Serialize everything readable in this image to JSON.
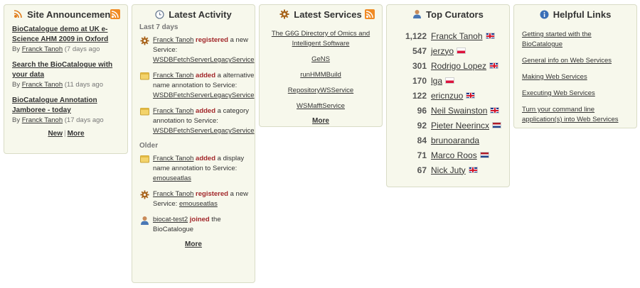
{
  "announcements": {
    "title": "Site Announcements",
    "icon": "broadcast-icon",
    "items": [
      {
        "title": "BioCatalogue demo at UK e-Science AHM 2009 in Oxford",
        "by": "By",
        "author": "Franck Tanoh",
        "ago": "(7 days ago"
      },
      {
        "title": "Search the BioCatalogue with your data",
        "by": "By",
        "author": "Franck Tanoh",
        "ago": "(11 days ago"
      },
      {
        "title": "BioCatalogue Annotation Jamboree - today",
        "by": "By",
        "author": "Franck Tanoh",
        "ago": "(17 days ago"
      }
    ],
    "new_label": "New",
    "separator": "|",
    "more_label": "More"
  },
  "activity": {
    "title": "Latest Activity",
    "icon": "clock-icon",
    "section_recent": "Last 7 days",
    "section_older": "Older",
    "recent": [
      {
        "icon": "gear-icon",
        "user": "Franck Tanoh",
        "verb": "registered",
        "text": "a new Service:",
        "target": "WSDBFetchServerLegacyService"
      },
      {
        "icon": "note-icon",
        "user": "Franck Tanoh",
        "verb": "added",
        "text": "a alternative name annotation to Service:",
        "target": "WSDBFetchServerLegacyService"
      },
      {
        "icon": "note-icon",
        "user": "Franck Tanoh",
        "verb": "added",
        "text": "a category annotation to Service:",
        "target": "WSDBFetchServerLegacyService"
      }
    ],
    "older": [
      {
        "icon": "note-icon",
        "user": "Franck Tanoh",
        "verb": "added",
        "text": "a display name annotation to Service:",
        "target": "emouseatlas"
      },
      {
        "icon": "gear-icon",
        "user": "Franck Tanoh",
        "verb": "registered",
        "text": "a new Service:",
        "target": "emouseatlas"
      },
      {
        "icon": "user-icon",
        "user": "biocat-test2",
        "verb": "joined",
        "text": "the BioCatalogue",
        "target": ""
      }
    ],
    "more_label": "More"
  },
  "services": {
    "title": "Latest Services",
    "icon": "gear-icon",
    "items": [
      "The G6G Directory of Omics and Intelligent Software",
      "GeNS",
      "runHMMBuild",
      "RepositoryWSService",
      "WSMafftService"
    ],
    "more_label": "More"
  },
  "curators": {
    "title": "Top Curators",
    "icon": "user-icon",
    "items": [
      {
        "count": "1,122",
        "name": "Franck Tanoh",
        "flag": "gb"
      },
      {
        "count": "547",
        "name": "jerzyo",
        "flag": "pl"
      },
      {
        "count": "301",
        "name": "Rodrigo Lopez",
        "flag": "gb"
      },
      {
        "count": "170",
        "name": "lga",
        "flag": "pl"
      },
      {
        "count": "122",
        "name": "ericnzuo",
        "flag": "gb"
      },
      {
        "count": "96",
        "name": "Neil Swainston",
        "flag": "gb"
      },
      {
        "count": "92",
        "name": "Pieter Neerincx",
        "flag": "nl"
      },
      {
        "count": "84",
        "name": "brunoaranda",
        "flag": ""
      },
      {
        "count": "71",
        "name": "Marco Roos",
        "flag": "nl"
      },
      {
        "count": "67",
        "name": "Nick Juty",
        "flag": "gb"
      }
    ]
  },
  "links": {
    "title": "Helpful Links",
    "icon": "info-icon",
    "items": [
      "Getting started with the BioCatalogue",
      "General info on Web Services",
      "Making Web Services",
      "Executing Web Services",
      "Turn your command line application(s) into Web Services"
    ]
  },
  "colors": {
    "panel_bg": "#f7f8ec",
    "panel_border": "#d9dcc6",
    "verb": "#a2272a",
    "rss": "#f08a24"
  }
}
